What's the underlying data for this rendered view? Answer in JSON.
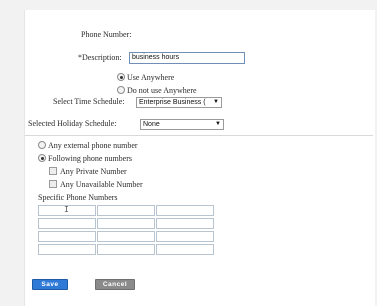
{
  "form": {
    "phone_number_label": "Phone Number:",
    "description_label": "*Description:",
    "description_value": "business hours",
    "use_anywhere_label": "Use Anywhere",
    "do_not_use_anywhere_label": "Do not use Anywhere",
    "time_schedule_label": "Select Time Schedule:",
    "time_schedule_value": "Enterprise Business (",
    "holiday_schedule_label": "Selected Holiday Schedule:",
    "holiday_schedule_value": "None",
    "any_external_label": "Any external phone number",
    "following_numbers_label": "Following phone numbers",
    "any_private_label": "Any Private Number",
    "any_unavailable_label": "Any Unavailable Number",
    "specific_numbers_label": "Specific Phone Numbers",
    "specific_numbers": [
      [
        "",
        "",
        ""
      ],
      [
        "",
        "",
        ""
      ],
      [
        "",
        "",
        ""
      ],
      [
        "",
        "",
        ""
      ]
    ]
  },
  "buttons": {
    "save_label": "Save",
    "cancel_label": "Cancel"
  },
  "state": {
    "usage": "Use Anywhere",
    "number_selection": "Following phone numbers",
    "any_private_checked": false,
    "any_unavailable_checked": false
  },
  "colors": {
    "save_button": "#2f7ad6",
    "cancel_button": "#8a8a8a",
    "input_border": "#6f8fb8"
  },
  "icons": {
    "select_arrow": "chevron-down-icon",
    "text_cursor": "i-beam-cursor-icon"
  }
}
